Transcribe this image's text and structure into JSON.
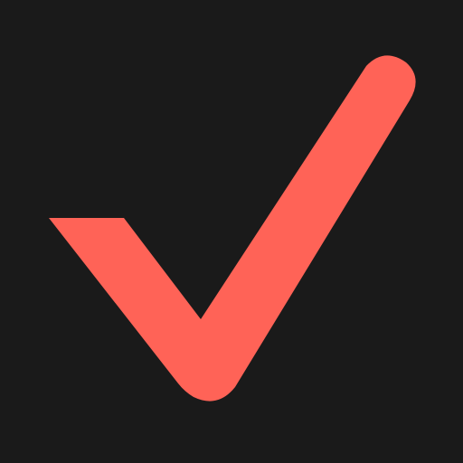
{
  "icon": {
    "name": "checkmark-icon",
    "background_color": "#1a1a1a",
    "accent_color": "#ff6357"
  }
}
